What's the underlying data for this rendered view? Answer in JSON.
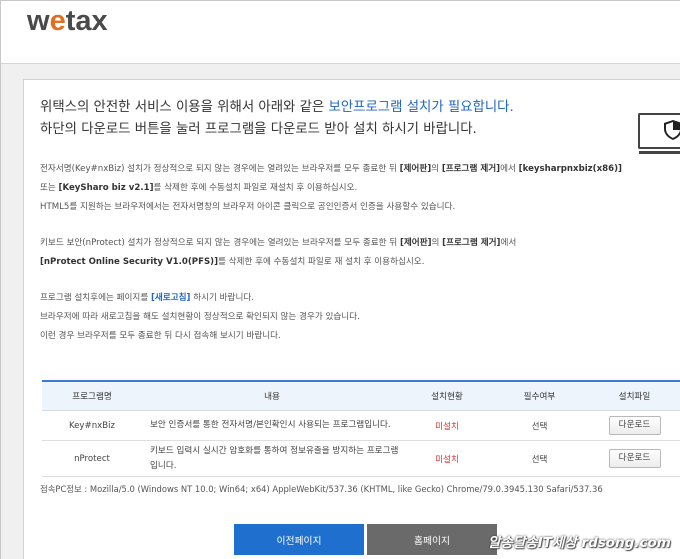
{
  "header": {
    "logo_w": "w",
    "logo_dot": "e",
    "logo_rest": "tax"
  },
  "intro": {
    "line1_pre": "위택스의 안전한 서비스 이용을 위해서 아래와 같은 ",
    "line1_hl": "보안프로그램 설치가 필요합니다.",
    "line2": "하단의 다운로드 버튼을 눌러 프로그램을 다운로드 받아 설치 하시기 바랍니다."
  },
  "notice1": {
    "l1_a": "전자서명(Key#nxBiz) 설치가 정상적으로 되지 않는 경우에는 열려있는 브라우저를 모두 종료한 뒤 ",
    "l1_b": "[제어판]",
    "l1_c": "의 ",
    "l1_d": "[프로그램 제거]",
    "l1_e": "에서 ",
    "l1_f": "[keysharpnxbiz(x86)]",
    "l2_a": "또는 ",
    "l2_b": "[KeySharo biz v2.1]",
    "l2_c": "를 삭제한 후에 수동설치 파일로 재설치 후 이용하십시오.",
    "l3": "HTML5를 지원하는 브라우저에서는 전자서명창의 브라우저 아이콘 클릭으로 공인인증서 인증을 사용할수 있습니다."
  },
  "notice2": {
    "l1_a": "키보드 보안(nProtect) 설치가 정상적으로 되지 않는 경우에는 열려있는 브라우저를 모두 종료한 뒤 ",
    "l1_b": "[제어판]",
    "l1_c": "의 ",
    "l1_d": "[프로그램 제거]",
    "l1_e": "에서",
    "l2_a": "[nProtect Online Security V1.0(PFS)]",
    "l2_b": "를 삭제한 후에 수동설치 파일로 재 설치 후 이용하십시오."
  },
  "notice3": {
    "l1_a": "프로그램 설치후에는 페이지를 ",
    "l1_b": "[새로고침]",
    "l1_c": " 하시기 바랍니다.",
    "l2": "브라우저에 따라 새로고침을 해도 설치현황이 정상적으로 확인되지 않는 경우가 있습니다.",
    "l3": "이런 경우 브라우저를 모두 종료한 뒤 다시 접속해 보시기 바랍니다."
  },
  "table": {
    "headers": [
      "프로그램명",
      "내용",
      "설치현황",
      "필수여부",
      "설치파일"
    ],
    "rows": [
      {
        "name": "Key#nxBiz",
        "desc": "보안 인증서를 통한 전자서명/본인확인시 사용되는 프로그램입니다.",
        "status": "미설치",
        "required": "선택",
        "button": "다운로드"
      },
      {
        "name": "nProtect",
        "desc": "키보드 입력시 실시간 암호화를 통하여 정보유출을 방지하는 프로그램입니다.",
        "status": "미설치",
        "required": "선택",
        "button": "다운로드"
      }
    ]
  },
  "user_agent": "접속PC정보 : Mozilla/5.0 (Windows NT 10.0; Win64; x64) AppleWebKit/537.36 (KHTML, like Gecko) Chrome/79.0.3945.130 Safari/537.36",
  "buttons": {
    "prev": "이전페이지",
    "home": "홈페이지"
  },
  "watermark": "알송달송IT세상 rdsong.com",
  "colors": {
    "accent": "#1f66c4",
    "status_red": "#e03030",
    "home_button": "#6a6a6a"
  }
}
